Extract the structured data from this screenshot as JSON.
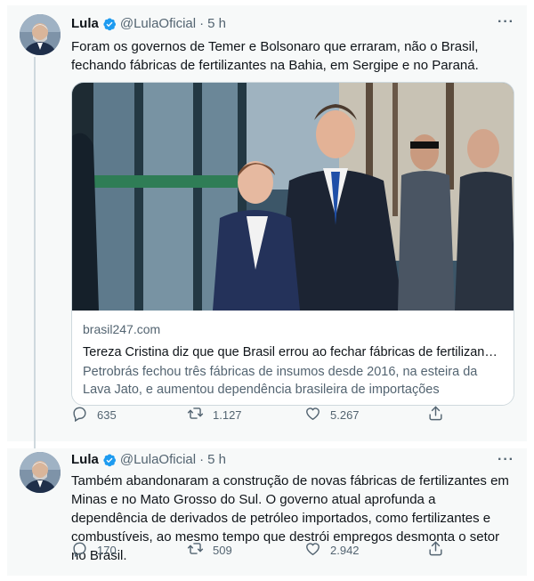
{
  "colors": {
    "accent": "#1d9bf0",
    "muted": "#536471",
    "text": "#0f1419",
    "border": "#cfd9de"
  },
  "tweets": [
    {
      "name": "Lula",
      "handle": "@LulaOficial",
      "dot": "·",
      "time": "5 h",
      "more": "···",
      "text": "Foram os governos de Temer e  Bolsonaro que erraram, não o Brasil, fechando fábricas de fertilizantes na Bahia, em Sergipe e no Paraná.",
      "card": {
        "domain": "brasil247.com",
        "title": "Tereza Cristina diz que que Brasil errou ao fechar fábricas de fertilizan…",
        "description": "Petrobrás fechou três fábricas de insumos desde 2016, na esteira da Lava Jato, e aumentou dependência brasileira de importações"
      },
      "replies": "635",
      "retweets": "1.127",
      "likes": "5.267"
    },
    {
      "name": "Lula",
      "handle": "@LulaOficial",
      "dot": "·",
      "time": "5 h",
      "more": "···",
      "text": "Também abandonaram a construção de novas fábricas de fertilizantes em Minas e no Mato Grosso do Sul. O governo atual aprofunda a dependência de derivados de petróleo importados, como fertilizantes e combustíveis, ao mesmo tempo que destrói empregos desmonta o setor no Brasil.",
      "replies": "170",
      "retweets": "509",
      "likes": "2.942"
    }
  ],
  "icons": {
    "reply": "reply-icon",
    "retweet": "retweet-icon",
    "like": "heart-icon",
    "share": "share-icon",
    "verified": "verified-badge-icon",
    "more": "more-icon"
  }
}
